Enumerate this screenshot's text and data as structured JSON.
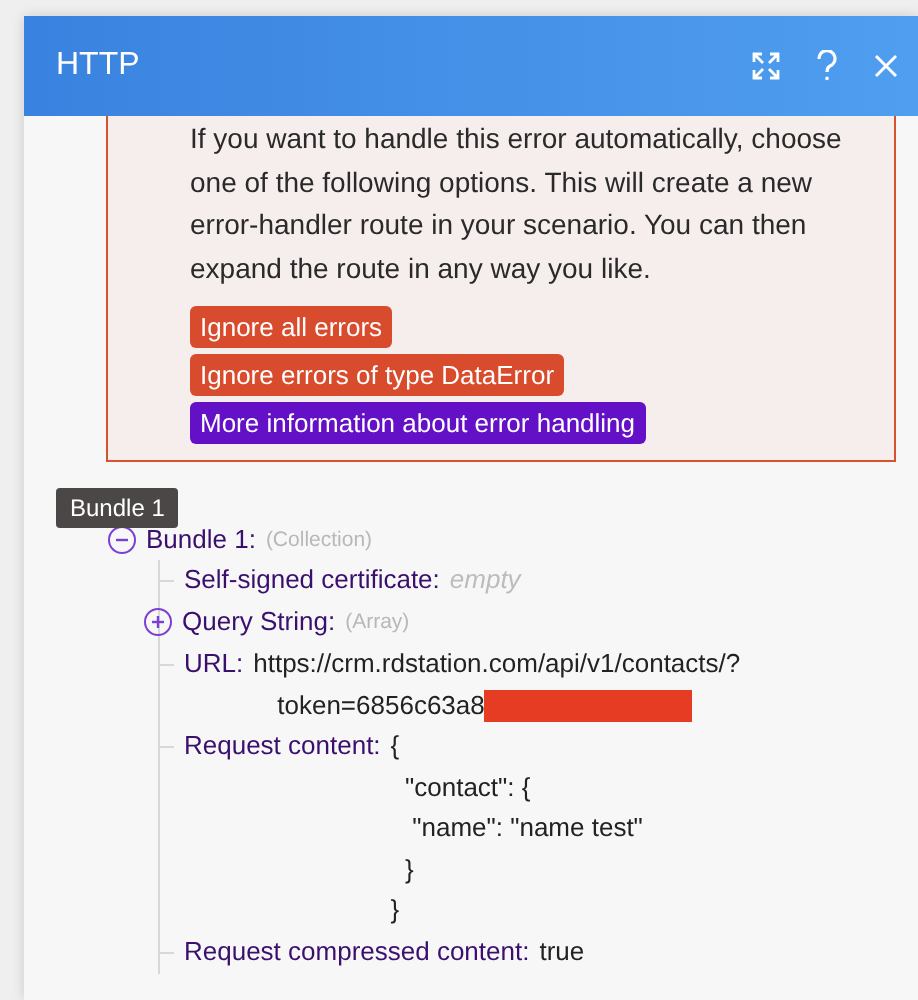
{
  "window": {
    "title": "HTTP"
  },
  "error_box": {
    "message": "If you want to handle this error automatically, choose one of the following options. This will create a new error-handler route in your scenario. You can then expand the route in any way you like.",
    "buttons": [
      {
        "label": "Ignore all errors",
        "kind": "danger"
      },
      {
        "label": "Ignore errors of type DataError",
        "kind": "danger"
      },
      {
        "label": "More information about error handling",
        "kind": "info"
      }
    ]
  },
  "tooltip": "Bundle 1",
  "tree": {
    "label": "Bundle 1:",
    "type_hint": "(Collection)",
    "expanded": true,
    "children": [
      {
        "label": "Self-signed certificate:",
        "value": "empty",
        "kind": "empty"
      },
      {
        "label": "Query String:",
        "type_hint": "(Array)",
        "kind": "collapsible",
        "expanded": false
      },
      {
        "label": "URL:",
        "value": "https://crm.rdstation.com/api/v1/contacts/?\ntoken=6856c63a8",
        "kind": "redacted"
      },
      {
        "label": "Request content:",
        "value": "{\n  \"contact\": {\n   \"name\": \"name test\"\n  }\n}",
        "kind": "value"
      },
      {
        "label": "Request compressed content:",
        "value": "true",
        "kind": "value"
      }
    ]
  }
}
